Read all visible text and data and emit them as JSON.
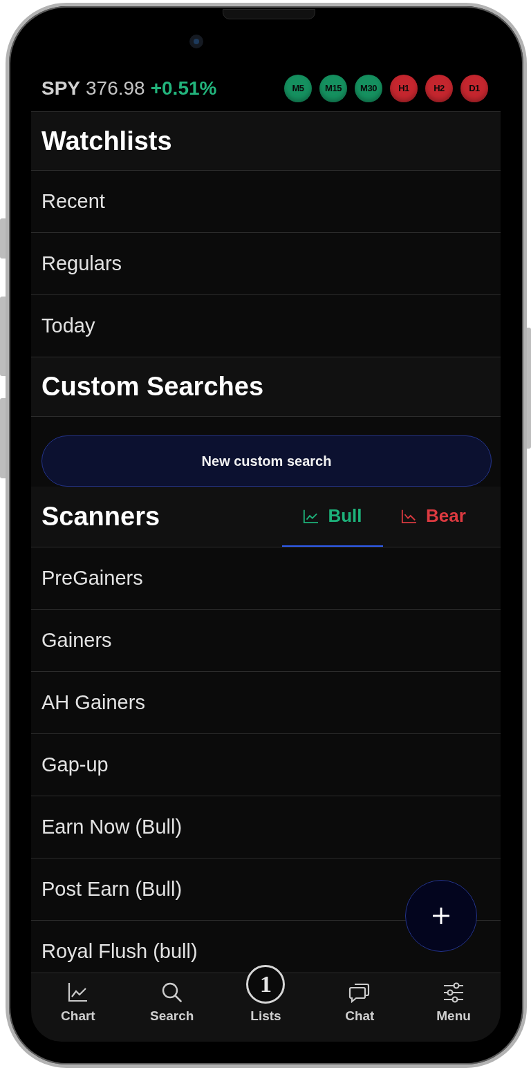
{
  "header": {
    "symbol": "SPY",
    "price": "376.98",
    "change": "+0.51%",
    "timeframes": [
      {
        "label": "M5",
        "color": "#15905f"
      },
      {
        "label": "M15",
        "color": "#15905f"
      },
      {
        "label": "M30",
        "color": "#15905f"
      },
      {
        "label": "H1",
        "color": "#c4262e"
      },
      {
        "label": "H2",
        "color": "#c4262e"
      },
      {
        "label": "D1",
        "color": "#c4262e"
      }
    ]
  },
  "watchlists": {
    "title": "Watchlists",
    "items": [
      "Recent",
      "Regulars",
      "Today"
    ]
  },
  "custom_searches": {
    "title": "Custom Searches",
    "button": "New custom search"
  },
  "scanners": {
    "title": "Scanners",
    "tabs": [
      {
        "label": "Bull",
        "kind": "bull",
        "selected": true
      },
      {
        "label": "Bear",
        "kind": "bear",
        "selected": false
      }
    ],
    "items": [
      "PreGainers",
      "Gainers",
      "AH Gainers",
      "Gap-up",
      "Earn Now (Bull)",
      "Post Earn (Bull)",
      "Royal Flush (bull)"
    ]
  },
  "bottom_nav": [
    {
      "kind": "chart",
      "label": "Chart"
    },
    {
      "kind": "search",
      "label": "Search"
    },
    {
      "kind": "logo",
      "logo": "1",
      "label": "Lists"
    },
    {
      "kind": "chat",
      "label": "Chat"
    },
    {
      "kind": "menu",
      "label": "Menu"
    }
  ]
}
